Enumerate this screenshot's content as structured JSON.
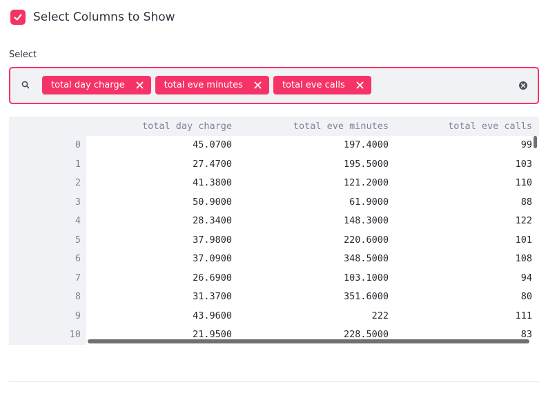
{
  "checkbox": {
    "label": "Select Columns to Show",
    "checked": true,
    "accent_color": "#f63366"
  },
  "select": {
    "label": "Select",
    "selected": [
      "total day charge",
      "total eve minutes",
      "total eve calls"
    ],
    "icons": {
      "search": "search-icon",
      "remove": "close-icon",
      "clear": "clear-circle-icon"
    }
  },
  "table": {
    "columns": [
      "total day charge",
      "total eve minutes",
      "total eve calls"
    ],
    "rows": [
      {
        "index": "0",
        "cells": [
          "45.0700",
          "197.4000",
          "99"
        ]
      },
      {
        "index": "1",
        "cells": [
          "27.4700",
          "195.5000",
          "103"
        ]
      },
      {
        "index": "2",
        "cells": [
          "41.3800",
          "121.2000",
          "110"
        ]
      },
      {
        "index": "3",
        "cells": [
          "50.9000",
          "61.9000",
          "88"
        ]
      },
      {
        "index": "4",
        "cells": [
          "28.3400",
          "148.3000",
          "122"
        ]
      },
      {
        "index": "5",
        "cells": [
          "37.9800",
          "220.6000",
          "101"
        ]
      },
      {
        "index": "6",
        "cells": [
          "37.0900",
          "348.5000",
          "108"
        ]
      },
      {
        "index": "7",
        "cells": [
          "26.6900",
          "103.1000",
          "94"
        ]
      },
      {
        "index": "8",
        "cells": [
          "31.3700",
          "351.6000",
          "80"
        ]
      },
      {
        "index": "9",
        "cells": [
          "43.9600",
          "222",
          "111"
        ]
      },
      {
        "index": "10",
        "cells": [
          "21.9500",
          "228.5000",
          "83"
        ]
      }
    ]
  }
}
